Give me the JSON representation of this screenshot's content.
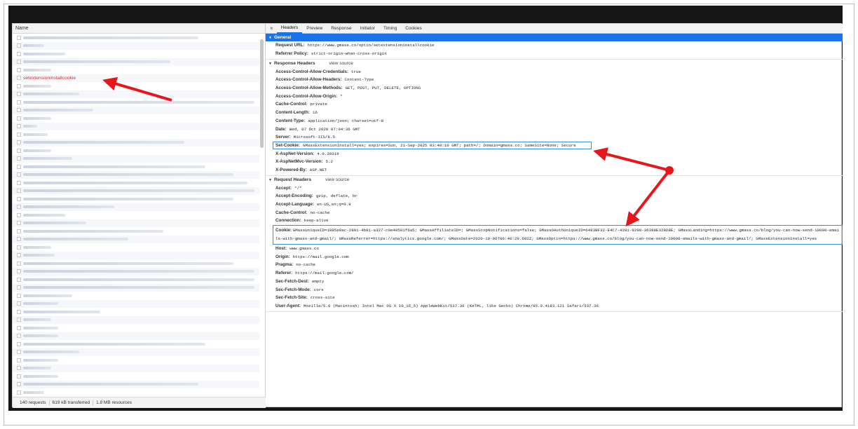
{
  "left": {
    "name_header": "Name",
    "highlighted_request": "setextensioninstallcookie",
    "blurred_rows_before": 5,
    "blurred_rows_after": 41,
    "status": {
      "requests": "140 requests",
      "transferred": "619 kB transferred",
      "resources": "1.8 MB resources"
    }
  },
  "tabs": {
    "close": "×",
    "items": [
      "Headers",
      "Preview",
      "Response",
      "Initiator",
      "Timing",
      "Cookies"
    ],
    "active": "Headers"
  },
  "general": {
    "title": "General",
    "request_url_key": "Request URL:",
    "request_url": "https://www.gmass.co/optin/setextensioninstallcookie",
    "referrer_policy_key": "Referrer Policy:",
    "referrer_policy": "strict-origin-when-cross-origin"
  },
  "response_headers": {
    "title": "Response Headers",
    "view_source": "view source",
    "items": [
      {
        "k": "Access-Control-Allow-Credentials:",
        "v": "true"
      },
      {
        "k": "Access-Control-Allow-Headers:",
        "v": "Content-Type"
      },
      {
        "k": "Access-Control-Allow-Methods:",
        "v": "GET, POST, PUT, DELETE, OPTIONS"
      },
      {
        "k": "Access-Control-Allow-Origin:",
        "v": "*"
      },
      {
        "k": "Cache-Control:",
        "v": "private"
      },
      {
        "k": "Content-Length:",
        "v": "16"
      },
      {
        "k": "Content-Type:",
        "v": "application/json; charset=utf-8"
      },
      {
        "k": "Date:",
        "v": "Wed, 07 Oct 2020 07:04:36 GMT"
      },
      {
        "k": "Server:",
        "v": "Microsoft-IIS/8.5"
      },
      {
        "k": "Set-Cookie:",
        "v": "GMassExtensionInstall=yes; expires=Sun, 21-Sep-2025 03:40:10 GMT; path=/; Domain=gmass.co; SameSite=None; Secure",
        "highlight": true
      },
      {
        "k": "X-AspNet-Version:",
        "v": "4.0.30319"
      },
      {
        "k": "X-AspNetMvc-Version:",
        "v": "5.2"
      },
      {
        "k": "X-Powered-By:",
        "v": "ASP.NET"
      }
    ]
  },
  "request_headers": {
    "title": "Request Headers",
    "view_source": "view source",
    "before_cookie": [
      {
        "k": "Accept:",
        "v": "*/*"
      },
      {
        "k": "Accept-Encoding:",
        "v": "gzip, deflate, br"
      },
      {
        "k": "Accept-Language:",
        "v": "en-US,en;q=0.9"
      },
      {
        "k": "Cache-Control:",
        "v": "no-cache"
      },
      {
        "k": "Connection:",
        "v": "keep-alive"
      }
    ],
    "cookie_key": "Cookie:",
    "cookie_value": "GMassUniqueID=1885e0ac-2891-4b81-a327-c0e40501f6a5; GMassAffiliateID=; GMassStopNotifications=false; GMassOAuthUniqueID=6483BF32-E4C7-4281-9298-36388E328D8E; GMassLanding=https://www.gmass.co/blog/you-can-now-send-10000-emails-with-gmass-and-gmail/; GMassReferrer=https://analytics.google.com/; GMassDate=2020-10-06T06:40:29.602Z; GMassOptin=https://www.gmass.co/blog/you-can-now-send-10000-emails-with-gmass-and-gmail/; GMassExtensionInstall=yes",
    "after_cookie": [
      {
        "k": "Host:",
        "v": "www.gmass.co"
      },
      {
        "k": "Origin:",
        "v": "https://mail.google.com"
      },
      {
        "k": "Pragma:",
        "v": "no-cache"
      },
      {
        "k": "Referer:",
        "v": "https://mail.google.com/"
      },
      {
        "k": "Sec-Fetch-Dest:",
        "v": "empty"
      },
      {
        "k": "Sec-Fetch-Mode:",
        "v": "cors"
      },
      {
        "k": "Sec-Fetch-Site:",
        "v": "cross-site"
      },
      {
        "k": "User-Agent:",
        "v": "Mozilla/5.0 (Macintosh; Intel Mac OS X 10_15_5) AppleWebKit/537.36 (KHTML, like Gecko) Chrome/85.0.4183.121 Safari/537.36"
      }
    ]
  },
  "colors": {
    "accent": "#1a73e8",
    "highlight_box": "#3a8fd6",
    "annotation_arrow": "#e8161b",
    "request_name": "#d32f2f"
  }
}
